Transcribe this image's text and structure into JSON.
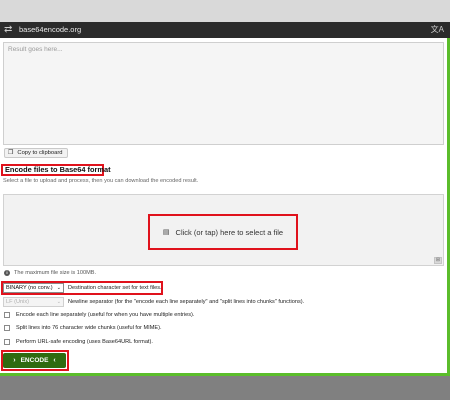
{
  "browser": {
    "url": "base64encode.org"
  },
  "result": {
    "placeholder": "Result goes here..."
  },
  "copy_button": {
    "label": "Copy to clipboard"
  },
  "section": {
    "heading": "Encode files to Base64 format",
    "subtitle": "Select a file to upload and process, then you can download the encoded result."
  },
  "dropzone": {
    "label": "Click (or tap) here to select a file"
  },
  "info": {
    "max_size": "The maximum file size is 100MB."
  },
  "charset": {
    "value": "BINARY (no conv.)",
    "label": "Destination character set for text files."
  },
  "newline": {
    "value": "LF (Unix)",
    "label": "Newline separator (for the \"encode each line separately\" and \"split lines into chunks\" functions)."
  },
  "options": [
    {
      "label": "Encode each line separately (useful for when you have multiple entries)."
    },
    {
      "label": "Split lines into 76 character wide chunks (useful for MIME)."
    },
    {
      "label": "Perform URL-safe encoding (uses Base64URL format)."
    }
  ],
  "encode_button": {
    "label": "ENCODE"
  },
  "colors": {
    "accent_green": "#5bbd2b",
    "button_green": "#2f6b10",
    "highlight_red": "#e0121c"
  }
}
